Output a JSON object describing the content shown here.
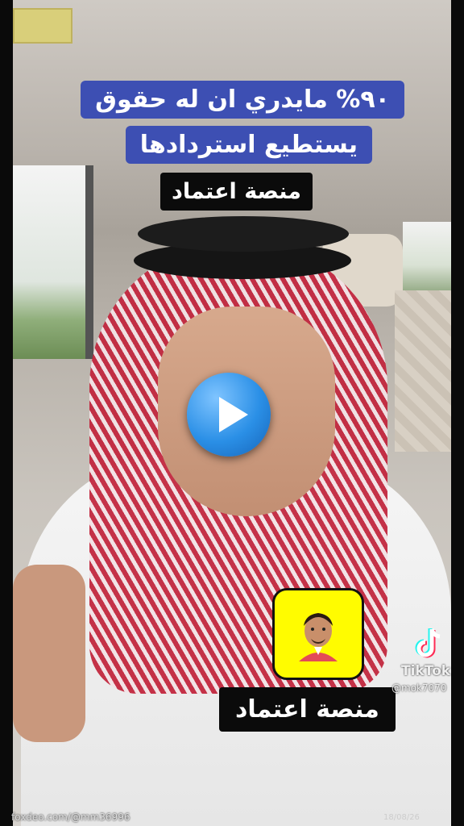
{
  "video": {
    "caption_line1": "٩٠% مايدري ان له حقوق",
    "caption_line2": "يستطيع استردادها",
    "label_top": "منصة اعتماد",
    "label_bottom": "منصة اعتماد",
    "play_icon": "play-icon",
    "snapchat_icon": "snapchat-bitmoji-icon"
  },
  "watermark": {
    "brand": "TikTok",
    "handle": "@mok7070",
    "icon": "tiktok-logo-icon"
  },
  "footer": {
    "source": "foxdeo.com/@mm36996",
    "date": "18/08/26"
  },
  "colors": {
    "caption_bg": "#3d4fb3",
    "label_bg": "#0b0b0b",
    "play_blue": "#2a8fe6",
    "snap_yellow": "#fffc00"
  }
}
